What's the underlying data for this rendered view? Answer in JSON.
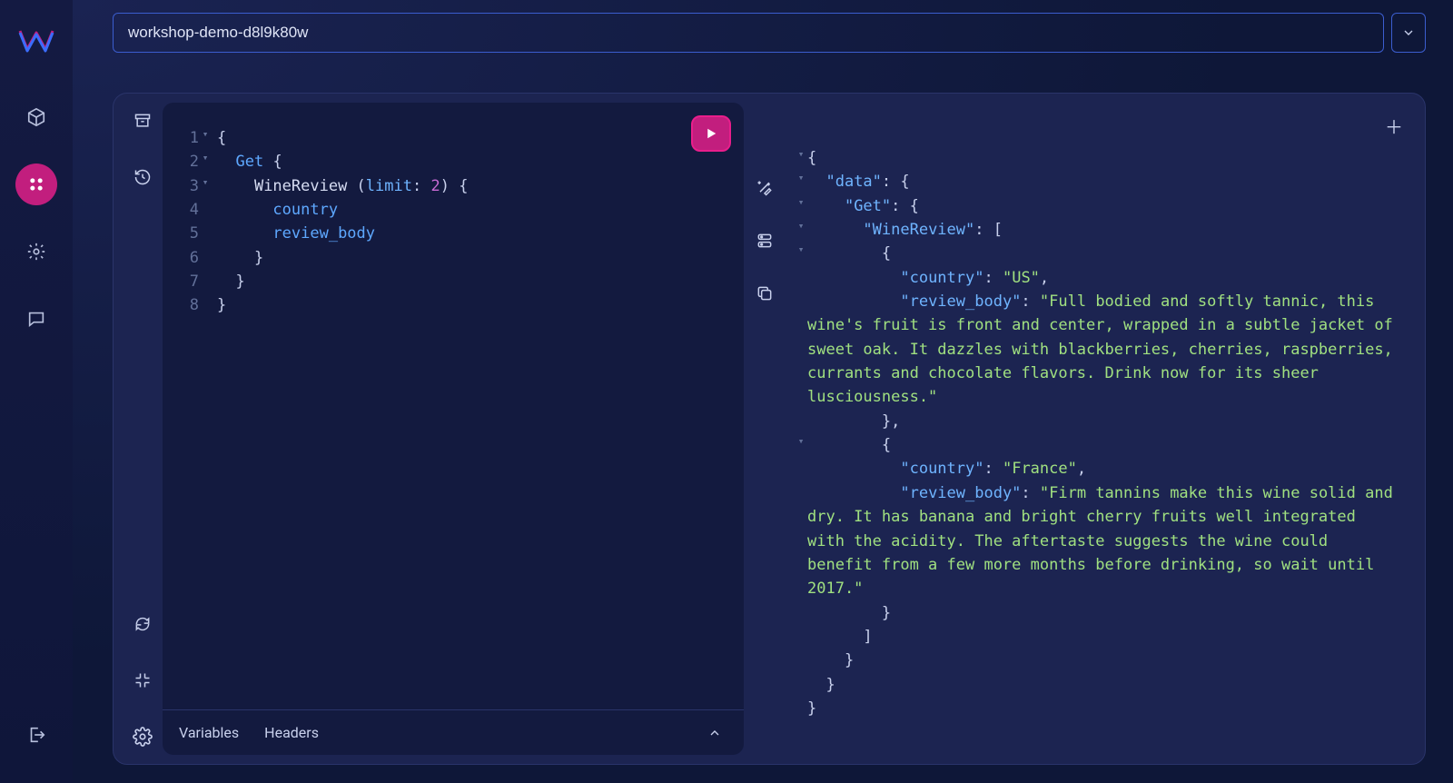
{
  "context_name": "workshop-demo-d8l9k80w",
  "editor": {
    "lines": [
      {
        "n": "1",
        "fold": "▾",
        "tokens": [
          {
            "t": "{",
            "c": "pn"
          }
        ]
      },
      {
        "n": "2",
        "fold": "▾",
        "tokens": [
          {
            "t": "  ",
            "c": "pn"
          },
          {
            "t": "Get",
            "c": "kw"
          },
          {
            "t": " {",
            "c": "pn"
          }
        ]
      },
      {
        "n": "3",
        "fold": "▾",
        "tokens": [
          {
            "t": "    ",
            "c": "pn"
          },
          {
            "t": "WineReview",
            "c": "cl"
          },
          {
            "t": " (",
            "c": "pn"
          },
          {
            "t": "limit",
            "c": "arg"
          },
          {
            "t": ": ",
            "c": "pn"
          },
          {
            "t": "2",
            "c": "num"
          },
          {
            "t": ") {",
            "c": "pn"
          }
        ]
      },
      {
        "n": "4",
        "fold": "",
        "tokens": [
          {
            "t": "      ",
            "c": "pn"
          },
          {
            "t": "country",
            "c": "fld"
          }
        ]
      },
      {
        "n": "5",
        "fold": "",
        "tokens": [
          {
            "t": "      ",
            "c": "pn"
          },
          {
            "t": "review_body",
            "c": "fld"
          }
        ]
      },
      {
        "n": "6",
        "fold": "",
        "tokens": [
          {
            "t": "    }",
            "c": "pn"
          }
        ]
      },
      {
        "n": "7",
        "fold": "",
        "tokens": [
          {
            "t": "  }",
            "c": "pn"
          }
        ]
      },
      {
        "n": "8",
        "fold": "",
        "tokens": [
          {
            "t": "}",
            "c": "pn"
          }
        ]
      }
    ],
    "tabs": {
      "variables": "Variables",
      "headers": "Headers"
    }
  },
  "results": [
    {
      "f": "▾",
      "seg": [
        {
          "t": "{",
          "c": "pn"
        }
      ]
    },
    {
      "f": "▾",
      "seg": [
        {
          "t": "  ",
          "c": "pn"
        },
        {
          "t": "\"data\"",
          "c": "key"
        },
        {
          "t": ": {",
          "c": "pn"
        }
      ]
    },
    {
      "f": "▾",
      "seg": [
        {
          "t": "    ",
          "c": "pn"
        },
        {
          "t": "\"Get\"",
          "c": "key"
        },
        {
          "t": ": {",
          "c": "pn"
        }
      ]
    },
    {
      "f": "▾",
      "seg": [
        {
          "t": "      ",
          "c": "pn"
        },
        {
          "t": "\"WineReview\"",
          "c": "key"
        },
        {
          "t": ": [",
          "c": "pn"
        }
      ]
    },
    {
      "f": "▾",
      "seg": [
        {
          "t": "        {",
          "c": "pn"
        }
      ]
    },
    {
      "f": "",
      "seg": [
        {
          "t": "          ",
          "c": "pn"
        },
        {
          "t": "\"country\"",
          "c": "key"
        },
        {
          "t": ": ",
          "c": "pn"
        },
        {
          "t": "\"US\"",
          "c": "str"
        },
        {
          "t": ",",
          "c": "pn"
        }
      ]
    },
    {
      "f": "",
      "seg": [
        {
          "t": "          ",
          "c": "pn"
        },
        {
          "t": "\"review_body\"",
          "c": "key"
        },
        {
          "t": ": ",
          "c": "pn"
        },
        {
          "t": "\"Full bodied and softly tannic, this wine's fruit is front and center, wrapped in a subtle jacket of sweet oak. It dazzles with blackberries, cherries, raspberries, currants and chocolate flavors. Drink now for its sheer lusciousness.\"",
          "c": "str"
        }
      ]
    },
    {
      "f": "",
      "seg": [
        {
          "t": "        },",
          "c": "pn"
        }
      ]
    },
    {
      "f": "▾",
      "seg": [
        {
          "t": "        {",
          "c": "pn"
        }
      ]
    },
    {
      "f": "",
      "seg": [
        {
          "t": "          ",
          "c": "pn"
        },
        {
          "t": "\"country\"",
          "c": "key"
        },
        {
          "t": ": ",
          "c": "pn"
        },
        {
          "t": "\"France\"",
          "c": "str"
        },
        {
          "t": ",",
          "c": "pn"
        }
      ]
    },
    {
      "f": "",
      "seg": [
        {
          "t": "          ",
          "c": "pn"
        },
        {
          "t": "\"review_body\"",
          "c": "key"
        },
        {
          "t": ": ",
          "c": "pn"
        },
        {
          "t": "\"Firm tannins make this wine solid and dry. It has banana and bright cherry fruits well integrated with the acidity. The aftertaste suggests the wine could benefit from a few more months before drinking, so wait until 2017.\"",
          "c": "str"
        }
      ]
    },
    {
      "f": "",
      "seg": [
        {
          "t": "        }",
          "c": "pn"
        }
      ]
    },
    {
      "f": "",
      "seg": [
        {
          "t": "      ]",
          "c": "pn"
        }
      ]
    },
    {
      "f": "",
      "seg": [
        {
          "t": "    }",
          "c": "pn"
        }
      ]
    },
    {
      "f": "",
      "seg": [
        {
          "t": "  }",
          "c": "pn"
        }
      ]
    },
    {
      "f": "",
      "seg": [
        {
          "t": "}",
          "c": "pn"
        }
      ]
    }
  ]
}
